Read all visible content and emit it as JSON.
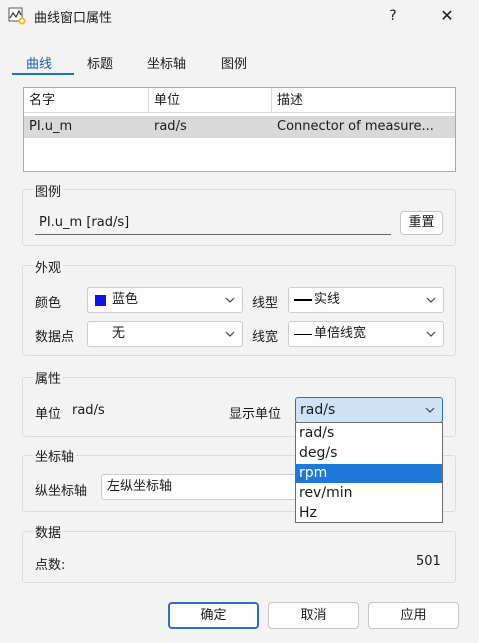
{
  "window": {
    "title": "曲线窗口属性",
    "help": "?",
    "close": "✕"
  },
  "tabs": [
    "曲线",
    "标题",
    "坐标轴",
    "图例"
  ],
  "curves": {
    "columns": [
      "名字",
      "单位",
      "描述"
    ],
    "rows": [
      {
        "name": "PI.u_m",
        "unit": "rad/s",
        "description": "Connector of measure..."
      }
    ]
  },
  "legend": {
    "title": "图例",
    "value": "PI.u_m [rad/s]",
    "reset_label": "重置"
  },
  "appearance": {
    "title": "外观",
    "color_label": "颜色",
    "color_value": "蓝色",
    "color_hex": "#1111ee",
    "linetype_label": "线型",
    "linetype_value": "实线",
    "datapoints_label": "数据点",
    "datapoints_value": "无",
    "linewidth_label": "线宽",
    "linewidth_value": "单倍线宽"
  },
  "properties": {
    "title": "属性",
    "unit_label": "单位",
    "unit_value": "rad/s",
    "display_unit_label": "显示单位",
    "display_unit_value": "rad/s",
    "display_unit_options": [
      "rad/s",
      "deg/s",
      "rpm",
      "rev/min",
      "Hz"
    ],
    "highlighted_option": "rpm"
  },
  "axis": {
    "title": "坐标轴",
    "vertical_label": "纵坐标轴",
    "vertical_value": "左纵坐标轴"
  },
  "data": {
    "title": "数据",
    "points_label": "点数:",
    "points_value": "501"
  },
  "buttons": {
    "ok": "确定",
    "cancel": "取消",
    "apply": "应用"
  }
}
